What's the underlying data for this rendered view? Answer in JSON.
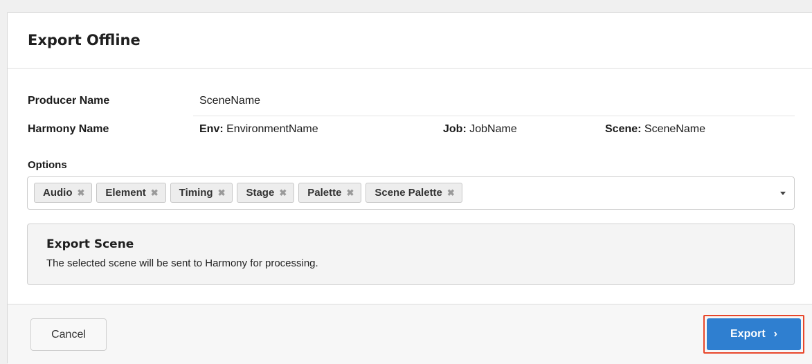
{
  "dialog": {
    "title": "Export Offline"
  },
  "fields": {
    "producer_label": "Producer Name",
    "producer_value": "SceneName",
    "harmony_label": "Harmony Name",
    "env_key": "Env:",
    "env_value": "EnvironmentName",
    "job_key": "Job:",
    "job_value": "JobName",
    "scene_key": "Scene:",
    "scene_value": "SceneName"
  },
  "options": {
    "label": "Options",
    "tags": [
      "Audio",
      "Element",
      "Timing",
      "Stage",
      "Palette",
      "Scene Palette"
    ],
    "remove_glyph": "✖"
  },
  "info": {
    "title": "Export Scene",
    "text": "The selected scene will be sent to Harmony for processing."
  },
  "footer": {
    "cancel_label": "Cancel",
    "export_label": "Export",
    "export_chevron": "›"
  },
  "colors": {
    "primary": "#2f7fd0",
    "highlight_outline": "#e8462a"
  }
}
